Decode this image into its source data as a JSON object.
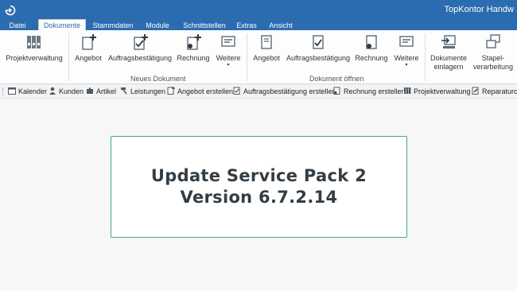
{
  "app": {
    "title": "TopKontor Handw"
  },
  "tabs": [
    {
      "label": "Datei"
    },
    {
      "label": "Dokumente"
    },
    {
      "label": "Stammdaten"
    },
    {
      "label": "Module"
    },
    {
      "label": "Schnittstellen"
    },
    {
      "label": "Extras"
    },
    {
      "label": "Ansicht"
    }
  ],
  "ribbon": {
    "projekt": {
      "label": "Projektverwaltung"
    },
    "neues_dokument": {
      "group_label": "Neues Dokument",
      "angebot": "Angebot",
      "auftrag": "Auftragsbestätigung",
      "rechnung": "Rechnung",
      "weitere": "Weitere",
      "caret": "▾"
    },
    "dokument_oeffnen": {
      "group_label": "Dokument öffnen",
      "angebot": "Angebot",
      "auftrag": "Auftragsbestätigung",
      "rechnung": "Rechnung",
      "weitere": "Weitere",
      "caret": "▾"
    },
    "einlagern": {
      "line1": "Dokumente",
      "line2": "einlagern"
    },
    "stapel": {
      "line1": "Stapel-",
      "line2": "verarbeitung"
    }
  },
  "quickbar": {
    "items": [
      {
        "label": "Kalender"
      },
      {
        "label": "Kunden"
      },
      {
        "label": "Artikel"
      },
      {
        "label": "Leistungen"
      },
      {
        "label": "Angebot erstellen"
      },
      {
        "label": "Auftragsbestätigung erstellen"
      },
      {
        "label": "Rechnung erstellen"
      },
      {
        "label": "Projektverwaltung"
      },
      {
        "label": "Reparaturce"
      }
    ]
  },
  "update": {
    "line1": "Update Service Pack 2",
    "line2": "Version 6.7.2.14"
  },
  "colors": {
    "titlebar": "#2b6cb0",
    "box_border": "#3ea79c",
    "text_dark": "#333d44"
  }
}
